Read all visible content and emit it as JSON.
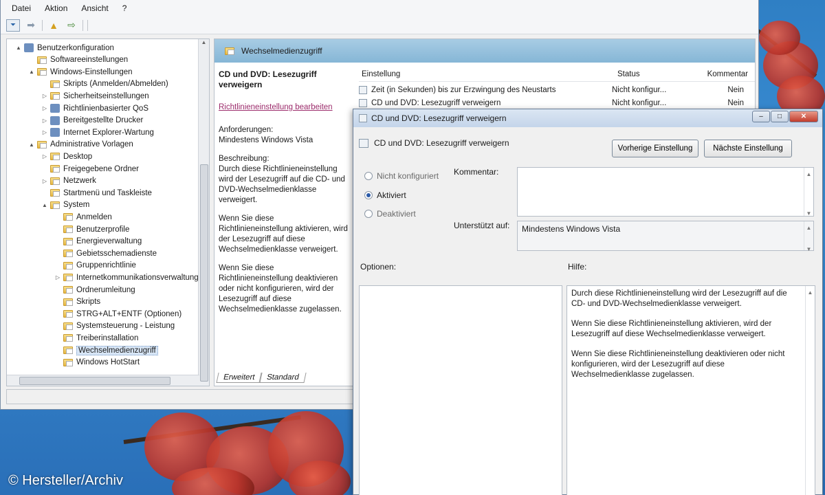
{
  "menu": [
    "Datei",
    "Aktion",
    "Ansicht",
    "?"
  ],
  "toolbar_icons": [
    "back-arrow-icon",
    "forward-arrow-icon",
    "up-folder-icon",
    "show-tree-icon",
    "export-icon",
    "help-icon",
    "properties-icon",
    "filter-icon"
  ],
  "tree": [
    {
      "label": "Benutzerkonfiguration",
      "indent": 0,
      "twisty": "▲",
      "icon": "gear"
    },
    {
      "label": "Softwareeinstellungen",
      "indent": 1,
      "twisty": "",
      "icon": "folder"
    },
    {
      "label": "Windows-Einstellungen",
      "indent": 1,
      "twisty": "▲",
      "icon": "folder"
    },
    {
      "label": "Skripts (Anmelden/Abmelden)",
      "indent": 2,
      "twisty": "",
      "icon": "folder"
    },
    {
      "label": "Sicherheitseinstellungen",
      "indent": 2,
      "twisty": "▷",
      "icon": "folder"
    },
    {
      "label": "Richtlinienbasierter QoS",
      "indent": 2,
      "twisty": "▷",
      "icon": "gear"
    },
    {
      "label": "Bereitgestellte Drucker",
      "indent": 2,
      "twisty": "▷",
      "icon": "gear"
    },
    {
      "label": "Internet Explorer-Wartung",
      "indent": 2,
      "twisty": "▷",
      "icon": "gear"
    },
    {
      "label": "Administrative Vorlagen",
      "indent": 1,
      "twisty": "▲",
      "icon": "folder"
    },
    {
      "label": "Desktop",
      "indent": 2,
      "twisty": "▷",
      "icon": "folder"
    },
    {
      "label": "Freigegebene Ordner",
      "indent": 2,
      "twisty": "",
      "icon": "folder"
    },
    {
      "label": "Netzwerk",
      "indent": 2,
      "twisty": "▷",
      "icon": "folder"
    },
    {
      "label": "Startmenü und Taskleiste",
      "indent": 2,
      "twisty": "",
      "icon": "folder"
    },
    {
      "label": "System",
      "indent": 2,
      "twisty": "▲",
      "icon": "folder"
    },
    {
      "label": "Anmelden",
      "indent": 3,
      "twisty": "",
      "icon": "folder"
    },
    {
      "label": "Benutzerprofile",
      "indent": 3,
      "twisty": "",
      "icon": "folder"
    },
    {
      "label": "Energieverwaltung",
      "indent": 3,
      "twisty": "",
      "icon": "folder"
    },
    {
      "label": "Gebietsschemadienste",
      "indent": 3,
      "twisty": "",
      "icon": "folder"
    },
    {
      "label": "Gruppenrichtlinie",
      "indent": 3,
      "twisty": "",
      "icon": "folder"
    },
    {
      "label": "Internetkommunikationsverwaltung",
      "indent": 3,
      "twisty": "▷",
      "icon": "folder"
    },
    {
      "label": "Ordnerumleitung",
      "indent": 3,
      "twisty": "",
      "icon": "folder"
    },
    {
      "label": "Skripts",
      "indent": 3,
      "twisty": "",
      "icon": "folder"
    },
    {
      "label": "STRG+ALT+ENTF (Optionen)",
      "indent": 3,
      "twisty": "",
      "icon": "folder"
    },
    {
      "label": "Systemsteuerung - Leistung",
      "indent": 3,
      "twisty": "",
      "icon": "folder"
    },
    {
      "label": "Treiberinstallation",
      "indent": 3,
      "twisty": "",
      "icon": "folder"
    },
    {
      "label": "Wechselmedienzugriff",
      "indent": 3,
      "twisty": "",
      "icon": "folder",
      "selected": true
    },
    {
      "label": "Windows HotStart",
      "indent": 3,
      "twisty": "",
      "icon": "folder"
    }
  ],
  "right_pane": {
    "header": "Wechselmedienzugriff",
    "desc_title": "CD und DVD: Lesezugriff verweigern",
    "edit_link": "Richtlinieneinstellung bearbeiten",
    "requirements": "Anforderungen:\nMindestens Windows Vista",
    "description": "Beschreibung:\nDurch diese Richtlinieneinstellung wird der Lesezugriff auf die CD- und DVD-Wechselmedienklasse verweigert.",
    "enable_text": "Wenn Sie diese Richtlinieneinstellung aktivieren, wird der Lesezugriff auf diese Wechselmedienklasse verweigert.",
    "disable_text": "Wenn Sie diese Richtlinieneinstellung deaktivieren oder nicht konfigurieren, wird der Lesezugriff auf diese Wechselmedienklasse zugelassen.",
    "columns": [
      "Einstellung",
      "Status",
      "Kommentar"
    ],
    "rows": [
      {
        "name": "Zeit (in Sekunden) bis zur Erzwingung des Neustarts",
        "status": "Nicht konfigur...",
        "comment": "Nein"
      },
      {
        "name": "CD und DVD: Lesezugriff verweigern",
        "status": "Nicht konfigur...",
        "comment": "Nein"
      }
    ],
    "tabs": [
      "Erweitert",
      "Standard"
    ]
  },
  "dialog": {
    "title": "CD und DVD: Lesezugriff verweigern",
    "subtitle": "CD und DVD: Lesezugriff verweigern",
    "prev_button": "Vorherige Einstellung",
    "next_button": "Nächste Einstellung",
    "radio_not_configured": "Nicht konfiguriert",
    "radio_enabled": "Aktiviert",
    "radio_disabled": "Deaktiviert",
    "selected_radio": "Aktiviert",
    "comment_label": "Kommentar:",
    "supported_label": "Unterstützt auf:",
    "supported_value": "Mindestens Windows Vista",
    "options_label": "Optionen:",
    "help_label": "Hilfe:",
    "help_p1": "Durch diese Richtlinieneinstellung wird der Lesezugriff auf die CD- und DVD-Wechselmedienklasse verweigert.",
    "help_p2": "Wenn Sie diese Richtlinieneinstellung aktivieren, wird der Lesezugriff auf diese Wechselmedienklasse verweigert.",
    "help_p3": "Wenn Sie diese Richtlinieneinstellung deaktivieren oder nicht konfigurieren, wird der Lesezugriff auf diese Wechselmedienklasse zugelassen."
  },
  "watermark": "© Hersteller/Archiv"
}
